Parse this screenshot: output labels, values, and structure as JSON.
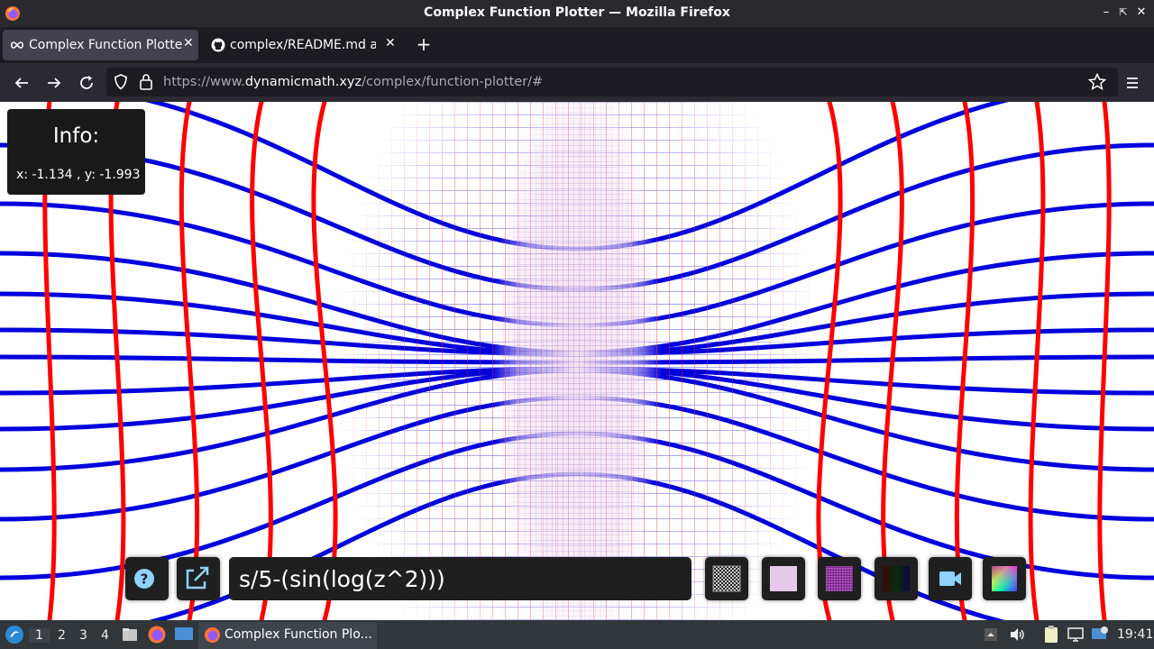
{
  "window": {
    "title": "Complex Function Plotter — Mozilla Firefox"
  },
  "tabs": [
    {
      "title": "Complex Function Plotter",
      "icon": "infinity-icon",
      "active": true
    },
    {
      "title": "complex/README.md at",
      "icon": "github-icon",
      "active": false
    }
  ],
  "navbar": {
    "url_prefix": "https://www.",
    "url_domain": "dynamicmath.xyz",
    "url_path": "/complex/function-plotter/#"
  },
  "info": {
    "title": "Info:",
    "coords": "x: -1.134 , y: -1.993"
  },
  "toolbar": {
    "formula": "s/5-(sin(log(z^2)))",
    "buttons": [
      "help-icon",
      "external-link-icon",
      "checker-pattern-icon",
      "lavender-swatch-icon",
      "purple-grid-icon",
      "dark-gradient-icon",
      "video-camera-icon",
      "color-wheel-icon"
    ]
  },
  "taskbar": {
    "workspaces": [
      "1",
      "2",
      "3",
      "4"
    ],
    "current_workspace": "1",
    "task_title": "Complex Function Plo...",
    "clock": "19:41"
  },
  "colors": {
    "grid_red": "#ff0000",
    "grid_blue": "#0000dd",
    "accent_lavender": "#e6c8ea"
  }
}
